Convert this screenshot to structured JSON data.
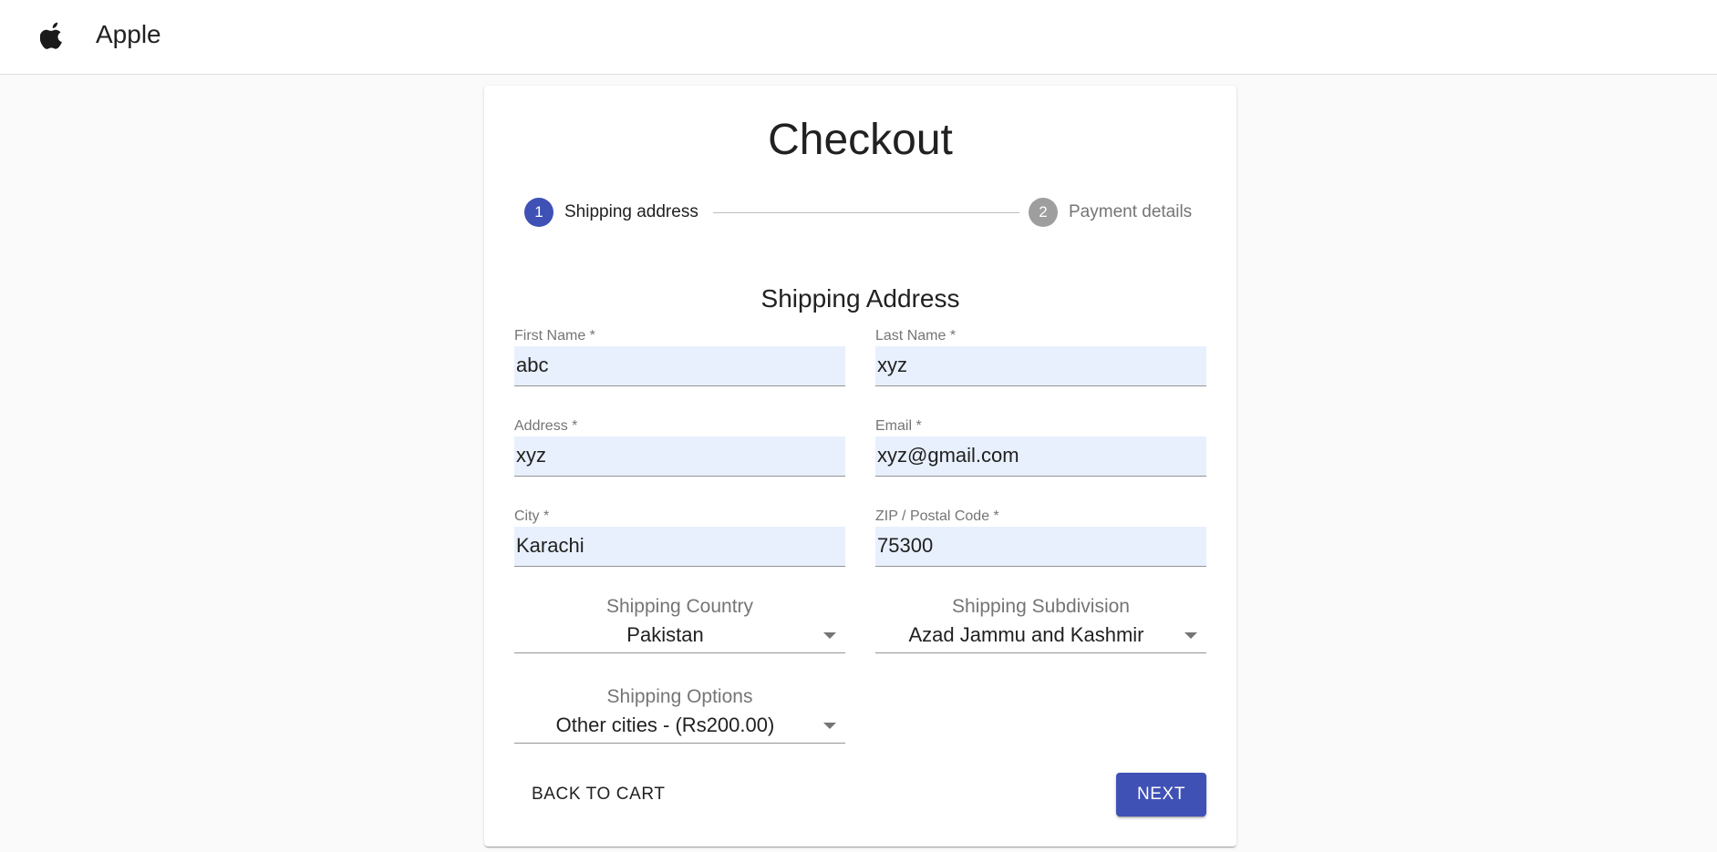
{
  "header": {
    "brand_name": "Apple",
    "logo_icon": "apple-logo-icon"
  },
  "checkout": {
    "title": "Checkout",
    "stepper": {
      "steps": [
        {
          "number": "1",
          "label": "Shipping address",
          "state": "active"
        },
        {
          "number": "2",
          "label": "Payment details",
          "state": "inactive"
        }
      ],
      "active_color": "#3f51b5",
      "inactive_color": "#9e9e9e"
    },
    "section_title": "Shipping Address",
    "fields": {
      "first_name": {
        "label": "First Name *",
        "value": "abc"
      },
      "last_name": {
        "label": "Last Name *",
        "value": "xyz"
      },
      "address": {
        "label": "Address *",
        "value": "xyz"
      },
      "email": {
        "label": "Email *",
        "value": "xyz@gmail.com"
      },
      "city": {
        "label": "City *",
        "value": "Karachi"
      },
      "zip": {
        "label": "ZIP / Postal Code *",
        "value": "75300"
      }
    },
    "selects": {
      "country": {
        "label": "Shipping Country",
        "value": "Pakistan"
      },
      "subdivision": {
        "label": "Shipping Subdivision",
        "value": "Azad Jammu and Kashmir"
      },
      "options": {
        "label": "Shipping Options",
        "value": "Other cities - (Rs200.00)"
      }
    },
    "buttons": {
      "back": "Back to Cart",
      "next": "Next"
    },
    "colors": {
      "primary": "#3f51b5",
      "autofill_background": "#e8f0fe"
    }
  }
}
